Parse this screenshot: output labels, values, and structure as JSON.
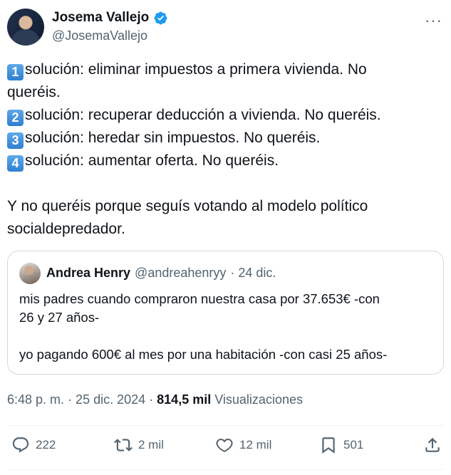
{
  "author": {
    "name": "Josema Vallejo",
    "handle": "@JosemaVallejo"
  },
  "tweet": {
    "lines": [
      {
        "num": "1",
        "text": "solución: eliminar impuestos a primera vivienda. No"
      },
      {
        "num": "",
        "text": "queréis."
      },
      {
        "num": "2",
        "text": "solución: recuperar deducción a vivienda. No queréis."
      },
      {
        "num": "3",
        "text": "solución: heredar sin impuestos. No queréis."
      },
      {
        "num": "4",
        "text": "solución: aumentar oferta. No queréis."
      }
    ],
    "closing_line1": "Y no queréis porque seguís votando al modelo político",
    "closing_line2": "socialdepredador."
  },
  "quote": {
    "name": "Andrea Henry",
    "handle": "@andreahenryy",
    "date": "· 24 dic.",
    "line1": "mis padres cuando compraron nuestra casa por 37.653€ -con",
    "line2": "26 y 27 años-",
    "line3": "yo pagando 600€ al mes por una habitación -con casi 25 años-"
  },
  "meta": {
    "time": "6:48 p. m.",
    "date": "· 25 dic. 2024 ·",
    "views_count": "814,5 mil",
    "views_label": "Visualizaciones"
  },
  "actions": {
    "replies": "222",
    "retweets": "2 mil",
    "likes": "12 mil",
    "bookmarks": "501"
  },
  "colors": {
    "verified": "#1d9bf0",
    "secondary_text": "#536471",
    "border": "#cfd9de"
  },
  "icons": [
    "verified-badge-icon",
    "more-options-icon",
    "reply-icon",
    "retweet-icon",
    "like-icon",
    "bookmark-icon",
    "share-icon"
  ]
}
